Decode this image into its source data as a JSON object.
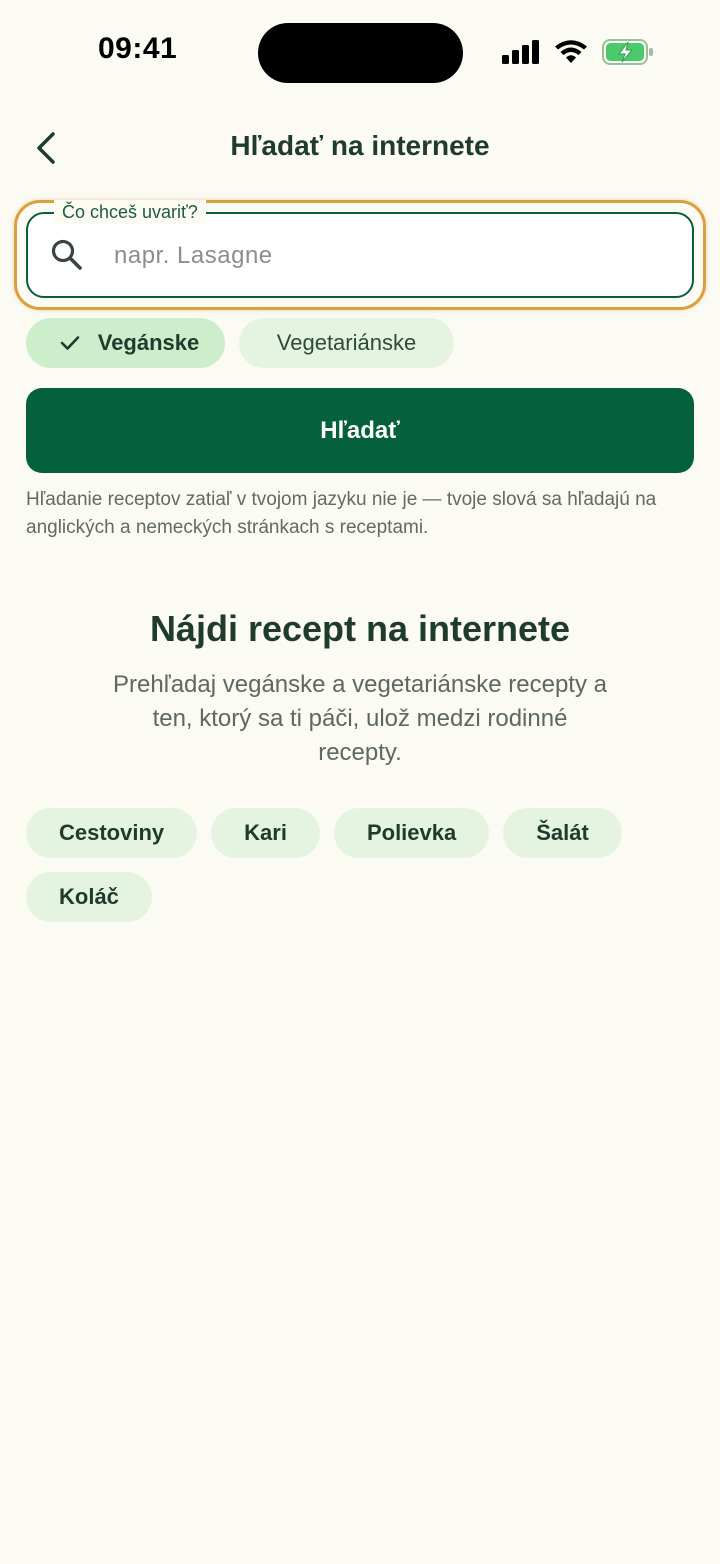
{
  "status_bar": {
    "time": "09:41"
  },
  "header": {
    "title": "Hľadať na internete",
    "back_icon": "chevron-left-icon"
  },
  "search": {
    "label": "Čo chceš uvariť?",
    "placeholder": "napr. Lasagne",
    "value": "",
    "icon": "search-icon"
  },
  "filters": [
    {
      "label": "Vegánske",
      "selected": true
    },
    {
      "label": "Vegetariánske",
      "selected": false
    }
  ],
  "search_button_label": "Hľadať",
  "info_note": "Hľadanie receptov zatiaľ v tvojom jazyku nie je — tvoje slová sa hľadajú na anglických a nemeckých stránkach s receptami.",
  "empty_state": {
    "title": "Nájdi recept na internete",
    "text": "Prehľadaj vegánske a vegetariánske recepty a ten, ktorý sa ti páči, ulož medzi rodinné recepty."
  },
  "suggestions": [
    "Cestoviny",
    "Kari",
    "Polievka",
    "Šalát",
    "Koláč"
  ],
  "colors": {
    "background": "#FBFAF3",
    "primary": "#05603D",
    "chip_selected": "#CDEECB",
    "chip": "#E4F4E1",
    "focus_ring": "#D9A13E",
    "text": "#1E3B2C"
  }
}
